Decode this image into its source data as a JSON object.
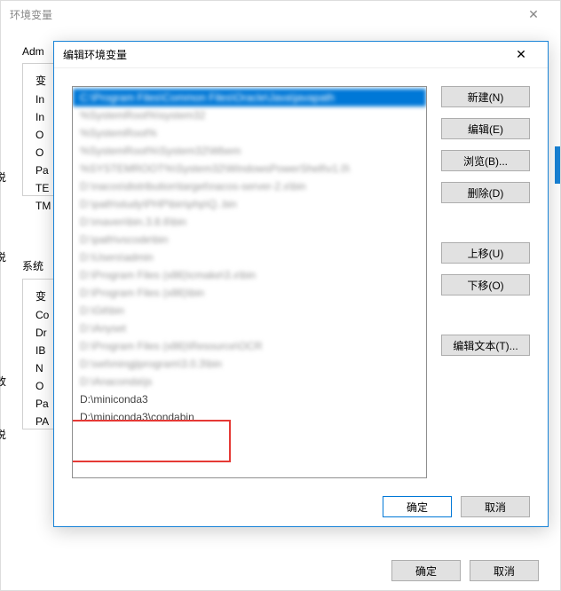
{
  "outer": {
    "title": "环境变量",
    "user_label": "Adm",
    "sys_label": "系统",
    "side1": "说",
    "side2": "说",
    "side3": "改",
    "side4": "说",
    "user_rows": [
      "变",
      "In",
      "In",
      "O",
      "O",
      "Pa",
      "TE",
      "TM"
    ],
    "sys_rows": [
      "变",
      "Co",
      "Dr",
      "IB",
      "N",
      "O",
      "Pa",
      "PA"
    ],
    "ok": "确定",
    "cancel": "取消"
  },
  "inner": {
    "title": "编辑环境变量",
    "list": [
      "C:\\Program Files\\Common Files\\Oracle\\Java\\javapath",
      "%SystemRoot%\\system32",
      "%SystemRoot%",
      "%SystemRoot%\\System32\\Wbem",
      "%SYSTEMROOT%\\System32\\WindowsPowerShell\\v1.0\\",
      "D:\\nacos\\distribution\\target\\nacos-server-2.x\\bin",
      "D:\\path\\study\\PHP\\bin\\php\\Q..bin",
      "D:\\maven\\bin.3.8.6\\bin",
      "D:\\path\\vscode\\bin",
      "D:\\Users\\admin",
      "D:\\Program Files (x86)\\cmake\\3.x\\bin",
      "D:\\Program Files (x86)\\bin",
      "D:\\Git\\bin",
      "D:\\Anyset",
      "D:\\Program Files (x86)\\Resource\\OCR",
      "D:\\set\\mingjiprogram\\3.0.3\\bin",
      "D:\\Anaconda\\js",
      "D:\\miniconda3",
      "D:\\miniconda3\\condabin"
    ],
    "buttons": {
      "new": "新建(N)",
      "edit": "编辑(E)",
      "browse": "浏览(B)...",
      "delete": "删除(D)",
      "up": "上移(U)",
      "down": "下移(O)",
      "edit_text": "编辑文本(T)..."
    },
    "ok": "确定",
    "cancel": "取消"
  }
}
